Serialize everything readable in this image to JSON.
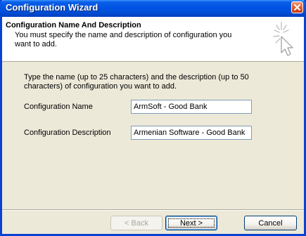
{
  "window": {
    "title": "Configuration Wizard"
  },
  "header": {
    "title": "Configuration Name And Description",
    "subtitle": "You must specify the name and description of configuration you want to add."
  },
  "body": {
    "instructions": "Type the name (up to 25 characters) and the description (up to 50 characters) of configuration you want to add.",
    "name_label": "Configuration Name",
    "name_value": "ArmSoft - Good Bank",
    "description_label": "Configuration Description",
    "description_value": "Armenian Software - Good Bank"
  },
  "buttons": {
    "back": "< Back",
    "next": "Next >",
    "cancel": "Cancel"
  },
  "icons": {
    "close": "close-icon",
    "wizard": "wizard-cursor-icon"
  },
  "colors": {
    "titlebar": "#0054e3",
    "close_button": "#e25b2c",
    "dialog_background": "#ece9d8"
  }
}
